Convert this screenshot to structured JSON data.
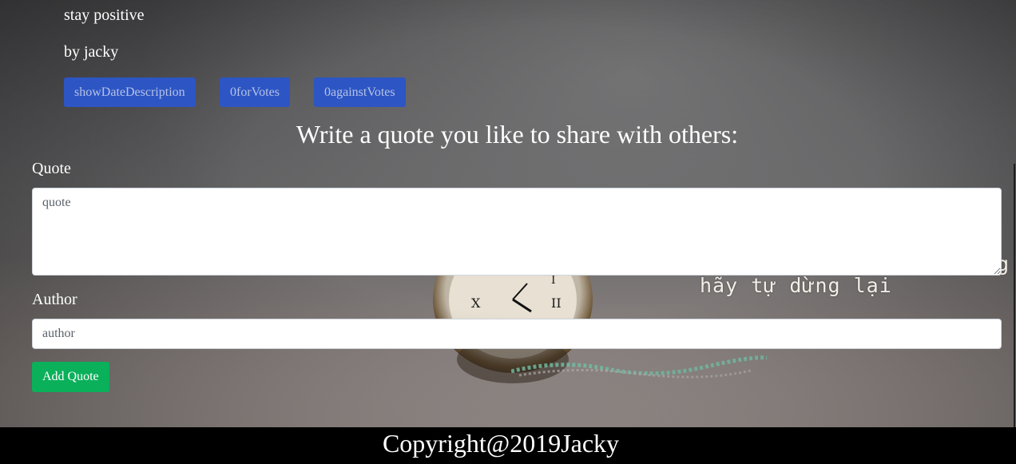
{
  "quote": {
    "text": "stay positive",
    "author_line": "by jacky",
    "buttons": {
      "show_date": "showDateDescription",
      "for_votes": "0forVotes",
      "against_votes": "0againstVotes"
    }
  },
  "form": {
    "title": "Write a quote you like to share with others:",
    "quote_label": "Quote",
    "quote_placeholder": "quote",
    "author_label": "Author",
    "author_placeholder": "author",
    "submit_label": "Add Quote"
  },
  "background": {
    "caption": "hãy tự dừng lại",
    "caption_clipped": "g"
  },
  "footer": {
    "text": "Copyright@2019Jacky"
  },
  "colors": {
    "vote_button": "#2d55c4",
    "submit_button": "#0ab05a",
    "footer_bg": "#000000"
  }
}
